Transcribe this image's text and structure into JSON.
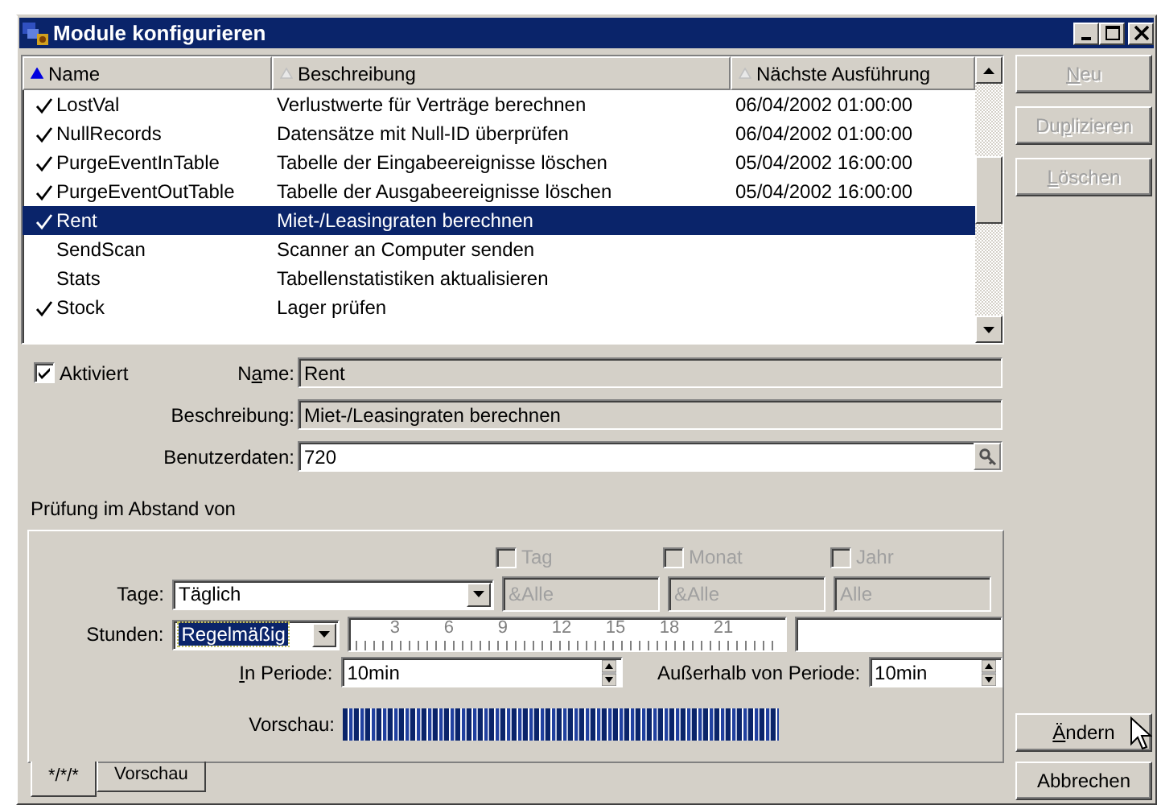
{
  "window": {
    "title": "Module konfigurieren"
  },
  "list": {
    "columns": [
      {
        "label": "Name",
        "sorted": true
      },
      {
        "label": "Beschreibung",
        "sorted": false
      },
      {
        "label": "Nächste Ausführung",
        "sorted": false
      }
    ],
    "rows": [
      {
        "name": "LostVal",
        "description": "Verlustwerte für Verträge berechnen",
        "next_run": "06/04/2002 01:00:00",
        "enabled": true,
        "selected": false
      },
      {
        "name": "NullRecords",
        "description": "Datensätze mit Null-ID überprüfen",
        "next_run": "06/04/2002 01:00:00",
        "enabled": true,
        "selected": false
      },
      {
        "name": "PurgeEventInTable",
        "description": "Tabelle der Eingabeereignisse löschen",
        "next_run": "05/04/2002 16:00:00",
        "enabled": true,
        "selected": false
      },
      {
        "name": "PurgeEventOutTable",
        "description": "Tabelle der Ausgabeereignisse löschen",
        "next_run": "05/04/2002 16:00:00",
        "enabled": true,
        "selected": false
      },
      {
        "name": "Rent",
        "description": "Miet-/Leasingraten berechnen",
        "enabled": true,
        "selected": true
      },
      {
        "name": "SendScan",
        "description": "Scanner an Computer senden",
        "enabled": false,
        "selected": false
      },
      {
        "name": "Stats",
        "description": "Tabellenstatistiken aktualisieren",
        "enabled": false,
        "selected": false
      },
      {
        "name": "Stock",
        "description": "Lager prüfen",
        "enabled": true,
        "selected": false
      }
    ]
  },
  "side_buttons": [
    {
      "key": "N",
      "post": "eu",
      "disabled": true
    },
    {
      "pre": "Du",
      "key": "p",
      "post": "lizieren",
      "disabled": true
    },
    {
      "key": "L",
      "post": "öschen",
      "disabled": true
    }
  ],
  "form": {
    "active": {
      "label": "Aktiviert",
      "checked": true
    },
    "fields": [
      {
        "kind": "readonly",
        "pre": "N",
        "key": "a",
        "post": "me:",
        "value": "Rent"
      },
      {
        "kind": "readonly",
        "pre": "Beschreibung:",
        "value": "Miet-/Leasingraten berechnen"
      },
      {
        "kind": "lookup",
        "pre": "Benutzerdaten:",
        "value": "720"
      }
    ]
  },
  "schedule": {
    "heading": "Prüfung im Abstand von",
    "period_checks": [
      {
        "label": "Tag",
        "checked": false,
        "disabled": true
      },
      {
        "label": "Monat",
        "checked": false,
        "disabled": true
      },
      {
        "label": "Jahr",
        "checked": false,
        "disabled": true
      }
    ],
    "days": {
      "label": "Tage:",
      "value": "Täglich"
    },
    "period_values": [
      "&Alle",
      "&Alle",
      "Alle"
    ],
    "hours": {
      "label": "Stunden:",
      "value": "Regelmäßig",
      "focused": true
    },
    "ruler_labels": [
      "3",
      "6",
      "9",
      "12",
      "15",
      "18",
      "21"
    ],
    "in_period": {
      "key": "I",
      "post": "n Periode:",
      "value": "10min"
    },
    "outside_period": {
      "label": "Außerhalb von Periode:",
      "value": "10min"
    },
    "preview_label": "Vorschau:",
    "tabs": [
      {
        "label": "*/*/*",
        "selected": true
      },
      {
        "label": "Vorschau",
        "selected": false
      }
    ]
  },
  "bottom_buttons": [
    {
      "key": "Ä",
      "post": "ndern",
      "disabled": false
    },
    {
      "pre": "Abbrechen",
      "disabled": false
    }
  ]
}
